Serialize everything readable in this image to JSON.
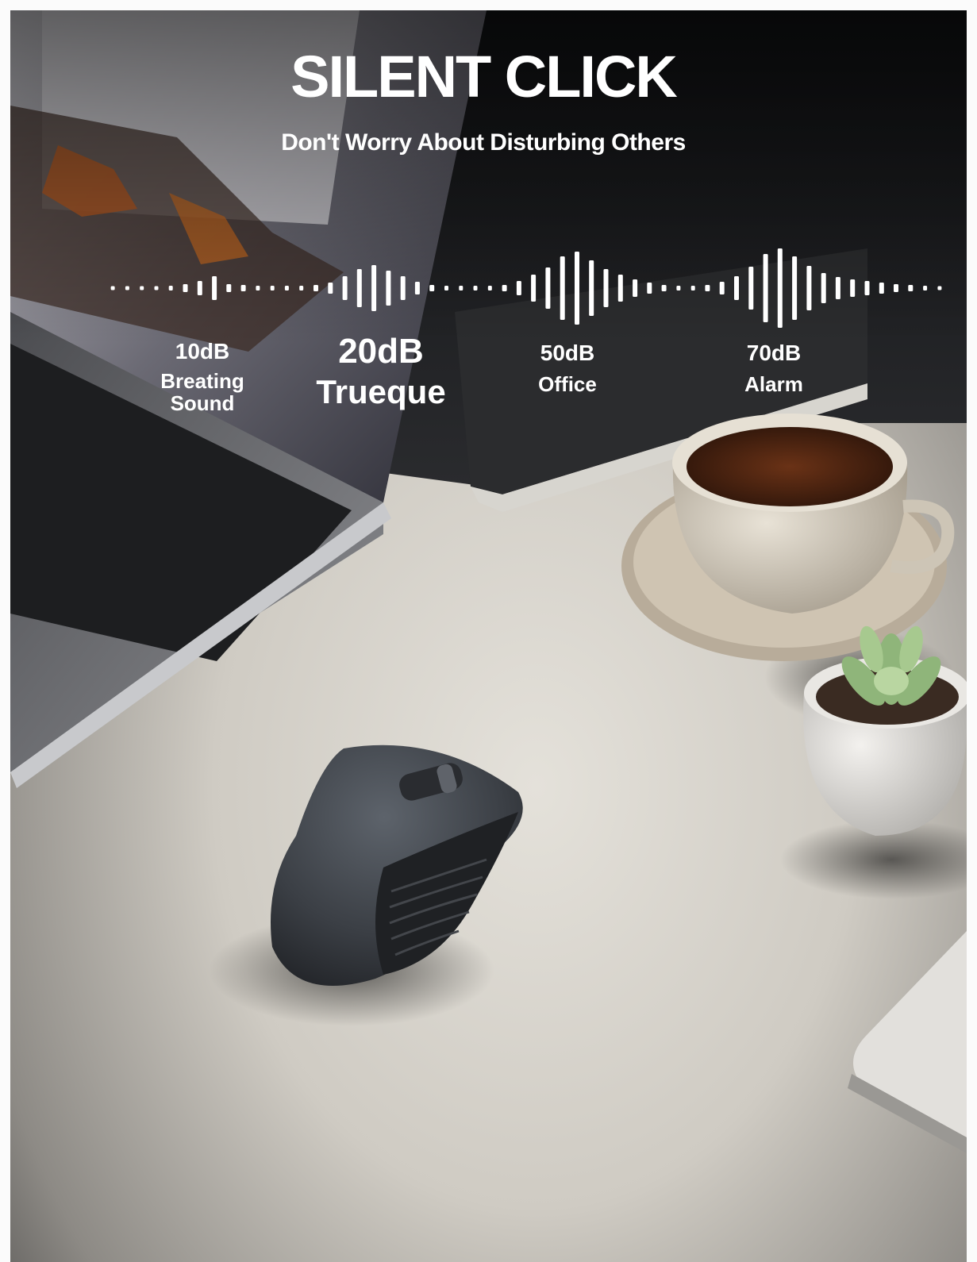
{
  "headline": "SILENT CLICK",
  "subheadline": "Don't Worry About Disturbing Others",
  "levels": [
    {
      "db": "10dB",
      "name_line1": "Breating",
      "name_line2": "Sound"
    },
    {
      "db": "20dB",
      "name_line1": "Trueque",
      "name_line2": ""
    },
    {
      "db": "50dB",
      "name_line1": "Office",
      "name_line2": ""
    },
    {
      "db": "70dB",
      "name_line1": "Alarm",
      "name_line2": ""
    }
  ],
  "colors": {
    "text": "#ffffff",
    "background_dark": "#1b1c1e",
    "desk": "#d9d6cf",
    "mouse": "#3a3e44",
    "tea": "#5a2a14"
  },
  "scene_objects": [
    "laptop",
    "wireless-mouse",
    "tea-cup",
    "saucer",
    "succulent-plant",
    "book"
  ]
}
